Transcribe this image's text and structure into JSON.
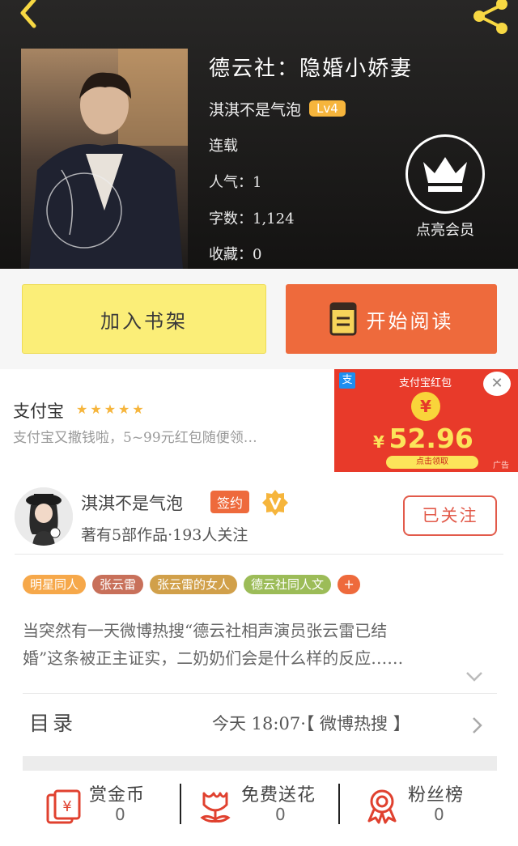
{
  "book": {
    "title": "德云社：隐婚小娇妻",
    "author": "淇淇不是气泡",
    "level": "Lv4",
    "status": "连载",
    "popularity": "人气：1",
    "word_count": "字数：1,124",
    "favorites": "收藏：0",
    "vip_label": "点亮会员"
  },
  "actions": {
    "add_shelf": "加入书架",
    "start_reading": "开始阅读"
  },
  "ad": {
    "name": "支付宝",
    "rating_stars": "★★★★★",
    "description": "支付宝又撒钱啦，5~99元红包随便领…",
    "banner": {
      "logo": "支",
      "title": "支付宝红包",
      "coin": "¥",
      "currency": "¥",
      "amount": "52.96",
      "claim": "点击领取",
      "ad_tag": "广告",
      "close": "✕"
    }
  },
  "author_card": {
    "name": "淇淇不是气泡",
    "sign_badge": "签约",
    "stats": "著有5部作品·193人关注",
    "follow_label": "已关注"
  },
  "tags": [
    {
      "label": "明星同人",
      "color": "#f6a84a"
    },
    {
      "label": "张云雷",
      "color": "#c8705a"
    },
    {
      "label": "张云雷的女人",
      "color": "#d1a04a"
    },
    {
      "label": "德云社同人文",
      "color": "#9cbc58"
    },
    {
      "label": "+",
      "color": "#ee6a3c"
    }
  ],
  "description": {
    "line1": "当突然有一天微博热搜“德云社相声演员张云雷已结",
    "line2": "婚”这条被正主证实，二奶奶们会是什么样的反应……"
  },
  "toc": {
    "label": "目录",
    "latest": "今天 18:07·【 微博热搜 】"
  },
  "bottom_bar": [
    {
      "label": "赏金币",
      "count": "0",
      "icon": "money-envelope-icon"
    },
    {
      "label": "免费送花",
      "count": "0",
      "icon": "flower-icon"
    },
    {
      "label": "粉丝榜",
      "count": "0",
      "icon": "ribbon-badge-icon"
    }
  ],
  "colors": {
    "accent_orange": "#ee6a3c",
    "shelf_yellow": "#fbee78",
    "level_badge": "#f6b53c",
    "follow_red": "#e25a4a",
    "icon_red": "#e0412f"
  }
}
